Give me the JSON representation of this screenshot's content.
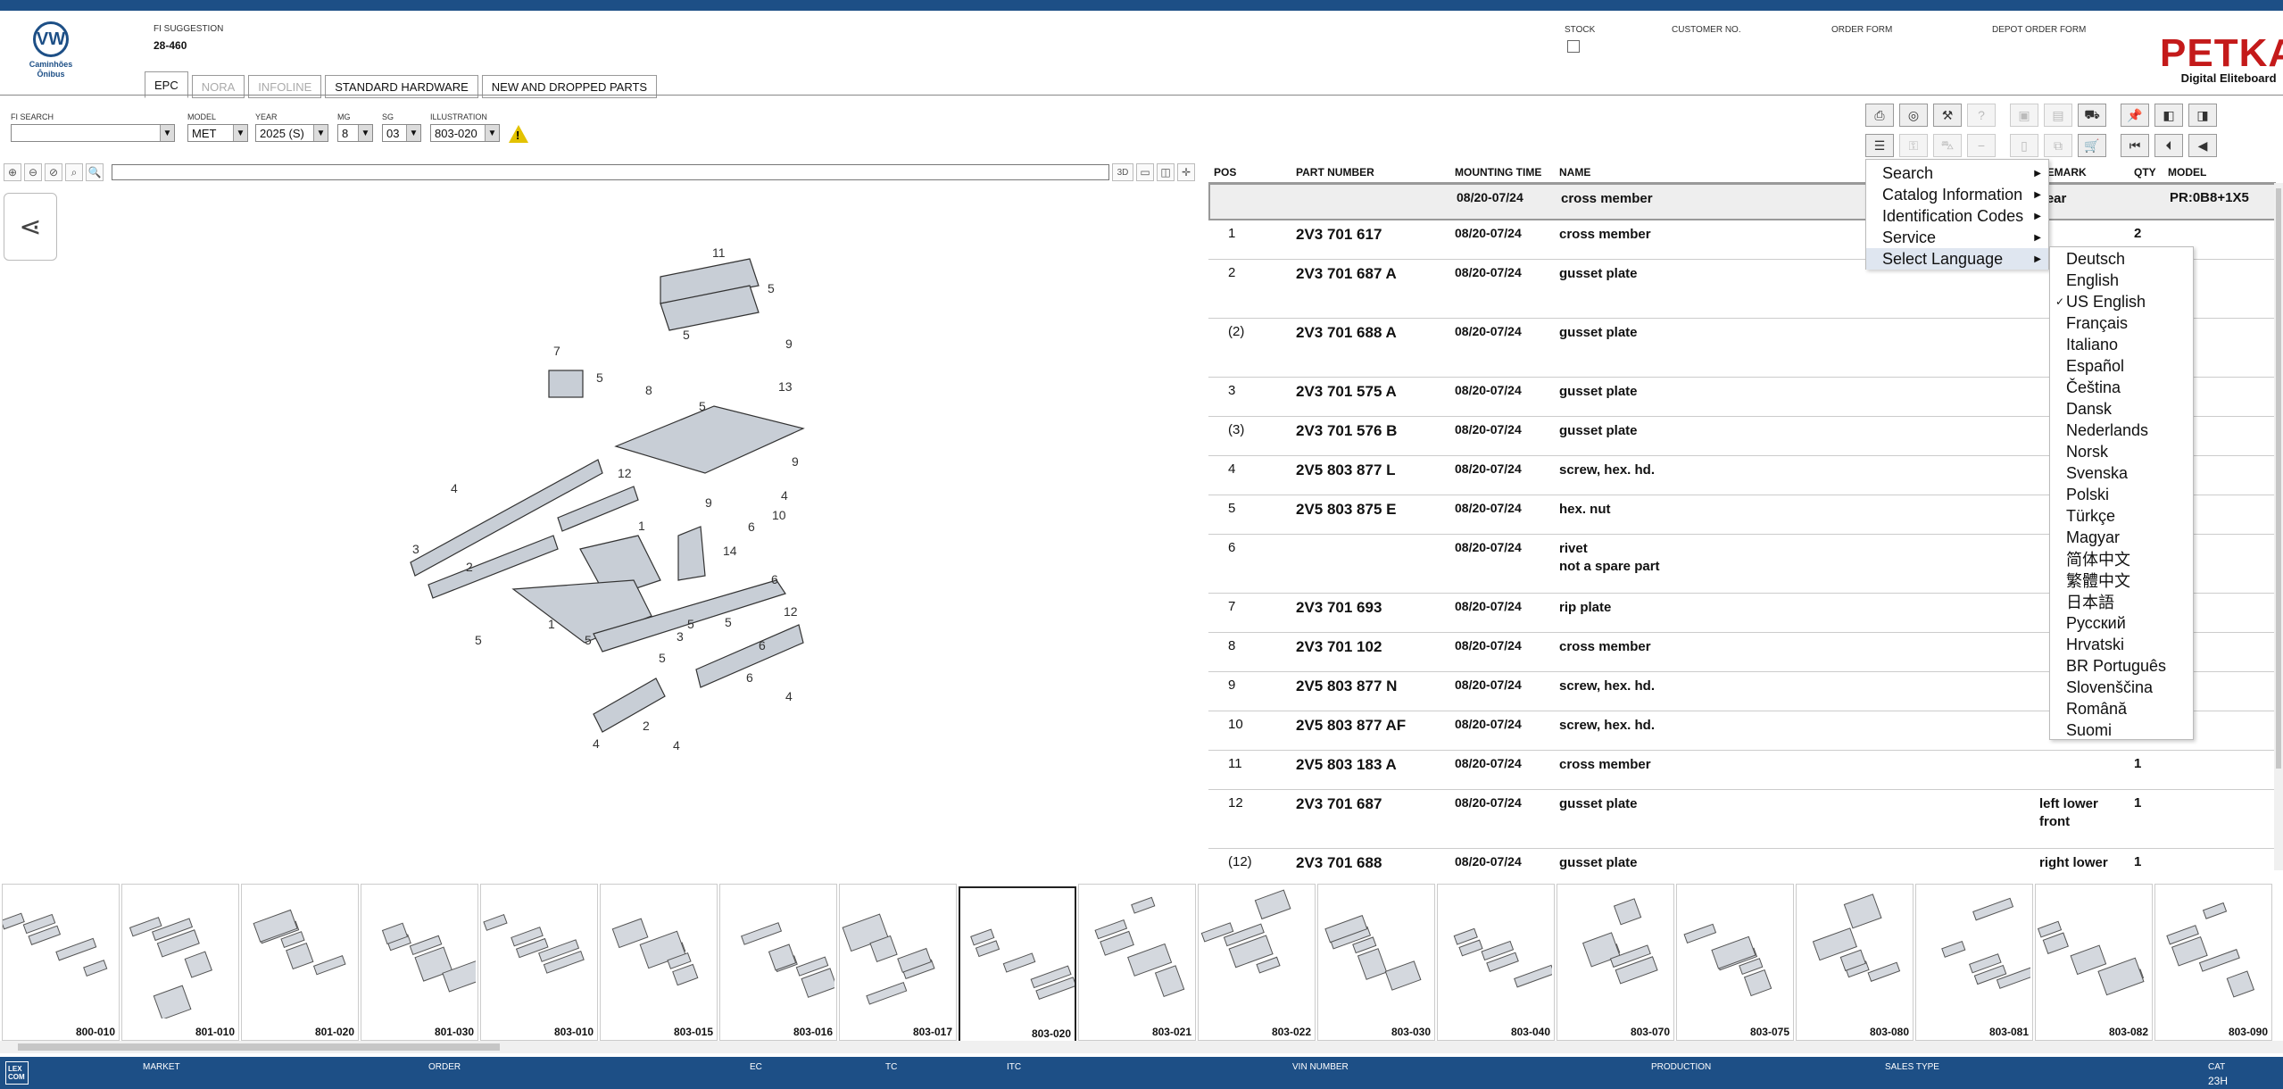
{
  "header": {
    "logo_text": "Caminhões Ônibus",
    "fi_suggestion_label": "FI SUGGESTION",
    "fi_suggestion_value": "28-460",
    "stock_label": "STOCK",
    "customer_no_label": "CUSTOMER NO.",
    "order_form_label": "ORDER FORM",
    "depot_order_form_label": "DEPOT ORDER FORM",
    "brand_name": "PETKA",
    "brand_tagline": "Digital Eliteboard"
  },
  "tabs": [
    {
      "label": "EPC",
      "active": true
    },
    {
      "label": "NORA",
      "disabled": true
    },
    {
      "label": "INFOLINE",
      "disabled": true
    },
    {
      "label": "STANDARD HARDWARE"
    },
    {
      "label": "NEW AND DROPPED PARTS"
    }
  ],
  "filters": {
    "fi_search_label": "FI SEARCH",
    "fi_search_value": "",
    "model_label": "MODEL",
    "model_value": "MET",
    "year_label": "YEAR",
    "year_value": "2025 (S)",
    "mg_label": "MG",
    "mg_value": "8",
    "sg_label": "SG",
    "sg_value": "03",
    "illustration_label": "ILLUSTRATION",
    "illustration_value": "803-020",
    "warning_symbol": "!"
  },
  "viewer": {
    "btn_3d": "3D"
  },
  "parts_table": {
    "columns": [
      "POS",
      "PART NUMBER",
      "MOUNTING TIME",
      "NAME",
      "REMARK",
      "QTY",
      "MODEL"
    ],
    "rows": [
      {
        "pos": "",
        "part": "",
        "mt": "08/20-07/24",
        "name": "cross member",
        "remark": "rear",
        "qty": "",
        "model": "PR:0B8+1X5"
      },
      {
        "pos": "1",
        "part": "2V3 701 617",
        "mt": "08/20-07/24",
        "name": "cross member",
        "remark": "",
        "qty": "2",
        "model": ""
      },
      {
        "pos": "2",
        "part": "2V3 701 687 A",
        "mt": "08/20-07/24",
        "name": "gusset plate",
        "remark": "",
        "qty": "",
        "model": ""
      },
      {
        "pos": "(2)",
        "part": "2V3 701 688 A",
        "mt": "08/20-07/24",
        "name": "gusset plate",
        "remark": "",
        "qty": "",
        "model": ""
      },
      {
        "pos": "3",
        "part": "2V3 701 575 A",
        "mt": "08/20-07/24",
        "name": "gusset plate",
        "remark": "",
        "qty": "",
        "model": ""
      },
      {
        "pos": "(3)",
        "part": "2V3 701 576 B",
        "mt": "08/20-07/24",
        "name": "gusset plate",
        "remark": "",
        "qty": "",
        "model": ""
      },
      {
        "pos": "4",
        "part": "2V5 803 877 L",
        "mt": "08/20-07/24",
        "name": "screw, hex. hd.",
        "remark": "",
        "qty": "",
        "model": ""
      },
      {
        "pos": "5",
        "part": "2V5 803 875 E",
        "mt": "08/20-07/24",
        "name": "hex. nut",
        "remark": "",
        "qty": "",
        "model": ""
      },
      {
        "pos": "6",
        "part": "",
        "mt": "08/20-07/24",
        "name": "rivet",
        "name2": "not a spare part",
        "remark": "",
        "qty": "",
        "model": ""
      },
      {
        "pos": "7",
        "part": "2V3 701 693",
        "mt": "08/20-07/24",
        "name": "rip plate",
        "remark": "",
        "qty": "",
        "model": ""
      },
      {
        "pos": "8",
        "part": "2V3 701 102",
        "mt": "08/20-07/24",
        "name": "cross member",
        "remark": "",
        "qty": "",
        "model": ""
      },
      {
        "pos": "9",
        "part": "2V5 803 877 N",
        "mt": "08/20-07/24",
        "name": "screw, hex. hd.",
        "remark": "",
        "qty": "",
        "model": ""
      },
      {
        "pos": "10",
        "part": "2V5 803 877 AF",
        "mt": "08/20-07/24",
        "name": "screw, hex. hd.",
        "remark": "",
        "qty": "",
        "model": ""
      },
      {
        "pos": "11",
        "part": "2V5 803 183 A",
        "mt": "08/20-07/24",
        "name": "cross member",
        "remark": "",
        "qty": "1",
        "model": ""
      },
      {
        "pos": "12",
        "part": "2V3 701 687",
        "mt": "08/20-07/24",
        "name": "gusset plate",
        "remark": "left lower",
        "remark2": "front",
        "qty": "1",
        "model": ""
      },
      {
        "pos": "(12)",
        "part": "2V3 701 688",
        "mt": "08/20-07/24",
        "name": "gusset plate",
        "remark": "right lower",
        "qty": "1",
        "model": ""
      }
    ]
  },
  "context_menu": {
    "items": [
      "Search",
      "Catalog Information",
      "Identification Codes",
      "Service",
      "Select Language"
    ]
  },
  "language_menu": {
    "selected": "US English",
    "items": [
      "Deutsch",
      "English",
      "US English",
      "Français",
      "Italiano",
      "Español",
      "Čeština",
      "Dansk",
      "Nederlands",
      "Norsk",
      "Svenska",
      "Polski",
      "Türkçe",
      "Magyar",
      "简体中文",
      "繁體中文",
      "日本語",
      "Русский",
      "Hrvatski",
      "BR Português",
      "Slovenščina",
      "Română",
      "Suomi"
    ]
  },
  "thumbnails": [
    "800-010",
    "801-010",
    "801-020",
    "801-030",
    "803-010",
    "803-015",
    "803-016",
    "803-017",
    "803-020",
    "803-021",
    "803-022",
    "803-030",
    "803-040",
    "803-070",
    "803-075",
    "803-080",
    "803-081",
    "803-082",
    "803-090"
  ],
  "thumbnail_selected": "803-020",
  "status_bar": {
    "logo": "LEX COM",
    "market_label": "MARKET",
    "order_label": "ORDER",
    "ec_label": "EC",
    "tc_label": "TC",
    "itc_label": "ITC",
    "vin_label": "VIN NUMBER",
    "production_label": "PRODUCTION",
    "sales_type_label": "SALES TYPE",
    "cat_label": "CAT",
    "cat_value": "23H"
  },
  "colors": {
    "accent": "#1d4f86",
    "brand_red": "#c41a1a",
    "warning": "#e3c200"
  }
}
